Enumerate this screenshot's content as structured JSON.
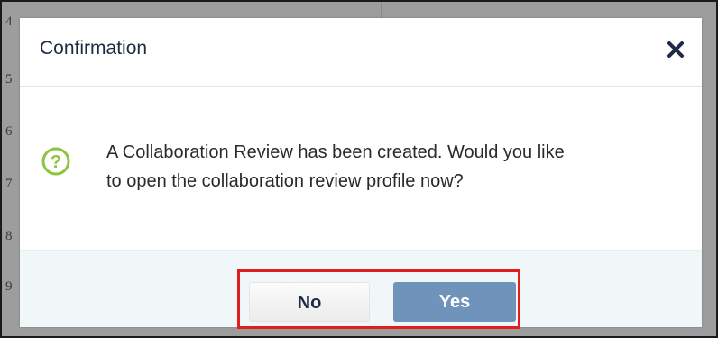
{
  "background": {
    "row_numbers": [
      "4",
      "5",
      "6",
      "7",
      "8",
      "9"
    ]
  },
  "dialog": {
    "title": "Confirmation",
    "close_icon": "close-icon",
    "question_icon": "question-circle-icon",
    "message_line1": "A Collaboration Review has been created. Would you like",
    "message_line2": "to open the collaboration review profile now?",
    "buttons": {
      "no_label": "No",
      "yes_label": "Yes"
    }
  },
  "colors": {
    "title": "#1f2a44",
    "question_icon": "#8cc63f",
    "yes_button": "#6f93ba",
    "highlight_border": "#e01e1e",
    "footer_bg": "#f1f7f8"
  }
}
